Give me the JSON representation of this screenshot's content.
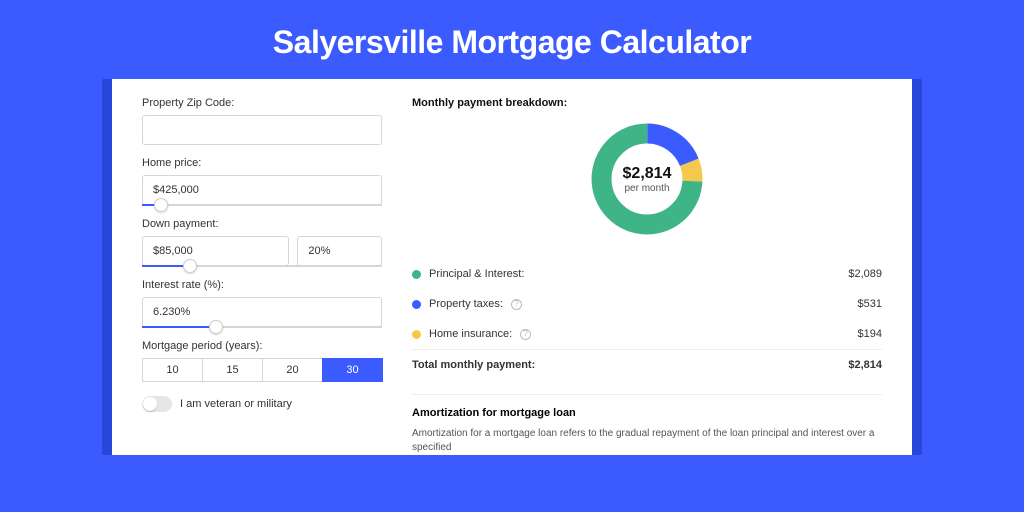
{
  "title": "Salyersville Mortgage Calculator",
  "form": {
    "zip_label": "Property Zip Code:",
    "zip_value": "",
    "home_price_label": "Home price:",
    "home_price_value": "$425,000",
    "home_price_slider_pct": 8,
    "down_label": "Down payment:",
    "down_value": "$85,000",
    "down_pct_value": "20%",
    "down_slider_pct": 20,
    "rate_label": "Interest rate (%):",
    "rate_value": "6.230%",
    "rate_slider_pct": 31,
    "period_label": "Mortgage period (years):",
    "periods": [
      "10",
      "15",
      "20",
      "30"
    ],
    "period_active": "30",
    "veteran_label": "I am veteran or military"
  },
  "breakdown": {
    "title": "Monthly payment breakdown:",
    "donut_amount": "$2,814",
    "donut_sub": "per month",
    "rows": [
      {
        "label": "Principal & Interest:",
        "value": "$2,089",
        "color": "#3fb487",
        "info": false
      },
      {
        "label": "Property taxes:",
        "value": "$531",
        "color": "#3c5bff",
        "info": true
      },
      {
        "label": "Home insurance:",
        "value": "$194",
        "color": "#f4c94b",
        "info": true
      }
    ],
    "total_label": "Total monthly payment:",
    "total_value": "$2,814"
  },
  "chart_data": {
    "type": "pie",
    "title": "Monthly payment breakdown",
    "series": [
      {
        "name": "Principal & Interest",
        "value": 2089,
        "color": "#3fb487"
      },
      {
        "name": "Property taxes",
        "value": 531,
        "color": "#3c5bff"
      },
      {
        "name": "Home insurance",
        "value": 194,
        "color": "#f4c94b"
      }
    ],
    "total": 2814
  },
  "amort": {
    "title": "Amortization for mortgage loan",
    "text": "Amortization for a mortgage loan refers to the gradual repayment of the loan principal and interest over a specified"
  }
}
